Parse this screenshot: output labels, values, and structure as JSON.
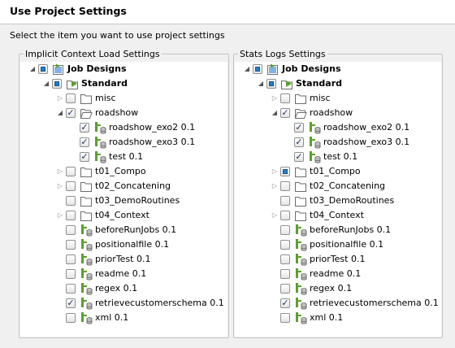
{
  "dialog": {
    "title": "Use Project Settings",
    "instruction": "Select the item you want to use project settings"
  },
  "panels": {
    "implicit": {
      "title": "Implicit Context Load Settings",
      "items": [
        {
          "label": "Job Designs",
          "indent": 0,
          "bold": true,
          "expander": "expanded",
          "check": "partial",
          "icon": "job-root"
        },
        {
          "label": "Standard",
          "indent": 1,
          "bold": true,
          "expander": "expanded",
          "check": "partial",
          "icon": "job-folder"
        },
        {
          "label": "misc",
          "indent": 2,
          "expander": "collapsed",
          "check": "unchecked",
          "icon": "folder"
        },
        {
          "label": "roadshow",
          "indent": 2,
          "expander": "expanded",
          "check": "checked",
          "icon": "folder-open"
        },
        {
          "label": "roadshow_exo2 0.1",
          "indent": 3,
          "check": "checked",
          "icon": "job"
        },
        {
          "label": "roadshow_exo3 0.1",
          "indent": 3,
          "check": "checked",
          "icon": "job"
        },
        {
          "label": "test 0.1",
          "indent": 3,
          "check": "checked",
          "icon": "job"
        },
        {
          "label": "t01_Compo",
          "indent": 2,
          "expander": "collapsed",
          "check": "unchecked",
          "icon": "folder"
        },
        {
          "label": "t02_Concatening",
          "indent": 2,
          "expander": "collapsed",
          "check": "unchecked",
          "icon": "folder"
        },
        {
          "label": "t03_DemoRoutines",
          "indent": 2,
          "check": "unchecked",
          "icon": "folder"
        },
        {
          "label": "t04_Context",
          "indent": 2,
          "expander": "collapsed",
          "check": "unchecked",
          "icon": "folder"
        },
        {
          "label": "beforeRunJobs 0.1",
          "indent": 2,
          "check": "unchecked",
          "icon": "job"
        },
        {
          "label": "positionalfile 0.1",
          "indent": 2,
          "check": "unchecked",
          "icon": "job"
        },
        {
          "label": "priorTest 0.1",
          "indent": 2,
          "check": "unchecked",
          "icon": "job"
        },
        {
          "label": "readme 0.1",
          "indent": 2,
          "check": "unchecked",
          "icon": "job"
        },
        {
          "label": "regex 0.1",
          "indent": 2,
          "check": "unchecked",
          "icon": "job"
        },
        {
          "label": "retrievecustomerschema 0.1",
          "indent": 2,
          "check": "checked",
          "icon": "job"
        },
        {
          "label": "xml 0.1",
          "indent": 2,
          "check": "unchecked",
          "icon": "job"
        }
      ]
    },
    "stats": {
      "title": "Stats  Logs Settings",
      "items": [
        {
          "label": "Job Designs",
          "indent": 0,
          "bold": true,
          "expander": "expanded",
          "check": "partial",
          "icon": "job-root"
        },
        {
          "label": "Standard",
          "indent": 1,
          "bold": true,
          "expander": "expanded",
          "check": "partial",
          "icon": "job-folder"
        },
        {
          "label": "misc",
          "indent": 2,
          "expander": "collapsed",
          "check": "unchecked",
          "icon": "folder"
        },
        {
          "label": "roadshow",
          "indent": 2,
          "expander": "expanded",
          "check": "checked",
          "icon": "folder-open"
        },
        {
          "label": "roadshow_exo2 0.1",
          "indent": 3,
          "check": "checked",
          "icon": "job"
        },
        {
          "label": "roadshow_exo3 0.1",
          "indent": 3,
          "check": "checked",
          "icon": "job"
        },
        {
          "label": "test 0.1",
          "indent": 3,
          "check": "checked",
          "icon": "job"
        },
        {
          "label": "t01_Compo",
          "indent": 2,
          "expander": "collapsed",
          "check": "partial",
          "icon": "folder"
        },
        {
          "label": "t02_Concatening",
          "indent": 2,
          "expander": "collapsed",
          "check": "unchecked",
          "icon": "folder"
        },
        {
          "label": "t03_DemoRoutines",
          "indent": 2,
          "check": "unchecked",
          "icon": "folder"
        },
        {
          "label": "t04_Context",
          "indent": 2,
          "expander": "collapsed",
          "check": "unchecked",
          "icon": "folder"
        },
        {
          "label": "beforeRunJobs 0.1",
          "indent": 2,
          "check": "unchecked",
          "icon": "job"
        },
        {
          "label": "positionalfile 0.1",
          "indent": 2,
          "check": "unchecked",
          "icon": "job"
        },
        {
          "label": "priorTest 0.1",
          "indent": 2,
          "check": "unchecked",
          "icon": "job"
        },
        {
          "label": "readme 0.1",
          "indent": 2,
          "check": "unchecked",
          "icon": "job"
        },
        {
          "label": "regex 0.1",
          "indent": 2,
          "check": "unchecked",
          "icon": "job"
        },
        {
          "label": "retrievecustomerschema 0.1",
          "indent": 2,
          "check": "checked",
          "icon": "job"
        },
        {
          "label": "xml 0.1",
          "indent": 2,
          "check": "unchecked",
          "icon": "job"
        }
      ]
    }
  },
  "colors": {
    "job_green": "#5aa02c",
    "folder_stroke": "#6b6b6b",
    "check_fill": "#1f7fcf"
  }
}
